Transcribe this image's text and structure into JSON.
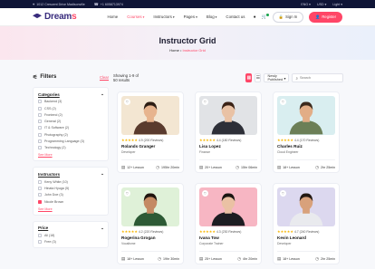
{
  "topbar": {
    "address": "1012 Crescent Drive Madisonville",
    "phone": "+1 6058713974",
    "language": "ENG",
    "currency": "USD",
    "mode": "Light"
  },
  "header": {
    "logo_main": "Dream",
    "logo_accent": "s",
    "nav": [
      {
        "label": "Home",
        "active": false
      },
      {
        "label": "Courses",
        "active": true
      },
      {
        "label": "Instructors",
        "active": false
      },
      {
        "label": "Pages",
        "active": false
      },
      {
        "label": "Blog",
        "active": false
      },
      {
        "label": "Contact us",
        "active": false
      }
    ],
    "signin_label": "Sign In",
    "register_label": "Register"
  },
  "hero": {
    "title": "Instructor Grid",
    "crumb_home": "Home",
    "crumb_sep": "•",
    "crumb_current": "Instructor Grid"
  },
  "filters": {
    "title": "Filters",
    "clear_label": "Clear",
    "categories": {
      "title": "Categories",
      "options": [
        "Backend (3)",
        "CSS (2)",
        "Frontend (2)",
        "General (2)",
        "IT & Software (2)",
        "Photography (2)",
        "Programming Language (3)",
        "Technology (2)"
      ],
      "see_more": "See More"
    },
    "instructors": {
      "title": "Instructors",
      "options": [
        {
          "label": "Keny White (10)",
          "checked": false
        },
        {
          "label": "Hinata Hyuga (5)",
          "checked": false
        },
        {
          "label": "John Doe (3)",
          "checked": false
        },
        {
          "label": "Nicole Brown",
          "checked": true
        }
      ],
      "see_more": "See More"
    },
    "price": {
      "title": "Price",
      "options": [
        "All (18)",
        "Free (3)"
      ]
    }
  },
  "toolbar": {
    "showing": "Showing 1-9 of 50 results",
    "sort": "Newly Published",
    "search_placeholder": "Search"
  },
  "instructors": [
    {
      "name": "Rolands Granger",
      "role": "Developer",
      "rating": "4.9",
      "reviews": "(200 Reviews)",
      "lessons": "12+ Lesson",
      "duration": "195hr 20min",
      "bg": "#f3e6d2",
      "shirt": "#5a3b2e",
      "skin": "#e7b48e",
      "hair": "#2c1d14"
    },
    {
      "name": "Lisa Lopez",
      "role": "Finance",
      "rating": "4.4",
      "reviews": "(180 Reviews)",
      "lessons": "20+ Lesson",
      "duration": "15hr 06min",
      "bg": "#e1e3e6",
      "shirt": "#2d2f38",
      "skin": "#e9c2a5",
      "hair": "#3a2216"
    },
    {
      "name": "Charles Ruiz",
      "role": "Cloud Engineer",
      "rating": "4.4",
      "reviews": "(170 Reviews)",
      "lessons": "18+ Lesson",
      "duration": "2hr 25min",
      "bg": "#d9eef0",
      "shirt": "#6c7f57",
      "skin": "#e2ad86",
      "hair": "#3b2a1d"
    },
    {
      "name": "Rogerina Grogan",
      "role": "Vocalisme",
      "rating": "4.2",
      "reviews": "(220 Reviews)",
      "lessons": "18+ Lesson",
      "duration": "19hr 30min",
      "bg": "#dff1d8",
      "shirt": "#2d5a35",
      "skin": "#c48a63",
      "hair": "#1f140e"
    },
    {
      "name": "Ivana Tow",
      "role": "Corporate Trainer",
      "rating": "4.3",
      "reviews": "(230 Reviews)",
      "lessons": "25+ Lesson",
      "duration": "4hr 20min",
      "bg": "#f7b6c3",
      "shirt": "#1d1d22",
      "skin": "#eac1a4",
      "hair": "#1b1512"
    },
    {
      "name": "Kevin Leonard",
      "role": "Developer",
      "rating": "4.7",
      "reviews": "(240 Reviews)",
      "lessons": "18+ Lesson",
      "duration": "2hr 25min",
      "bg": "#dcd8ef",
      "shirt": "#e9eaee",
      "skin": "#d8a17b",
      "hair": "#221812"
    }
  ],
  "colors": {
    "accent": "#ff4667",
    "brand": "#392c7d",
    "star": "#f7b500"
  }
}
